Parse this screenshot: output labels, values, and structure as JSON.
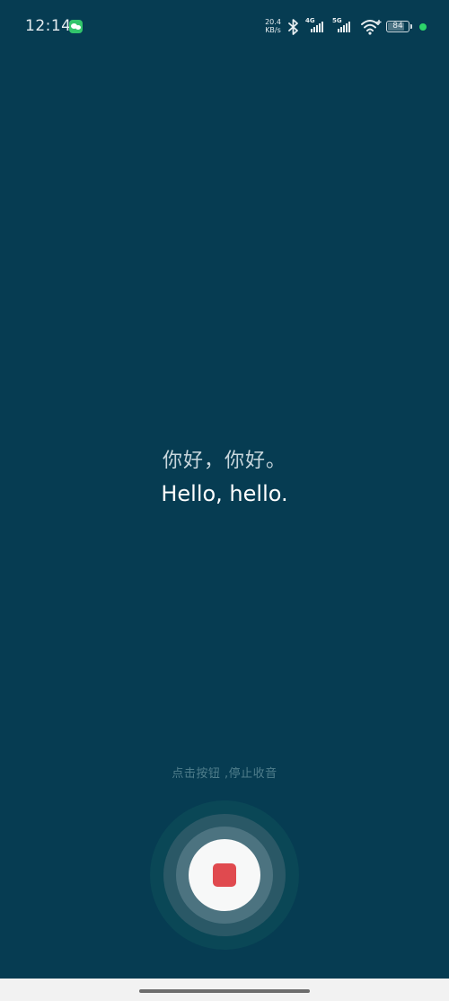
{
  "status_bar": {
    "time": "12:14",
    "notification_icon": "wechat-icon",
    "net_speed_value": "20.4",
    "net_speed_unit": "KB/s",
    "bluetooth_icon": "bluetooth-icon",
    "signal_1_tag": "4G",
    "signal_2_tag": "5G",
    "wifi_icon": "wifi-icon",
    "battery_level": "84",
    "battery_fraction": 0.84,
    "privacy_dot_color": "#2dd46a"
  },
  "transcript": {
    "source_text": "你好，你好。",
    "translated_text": "Hello, hello."
  },
  "controls": {
    "hint": "点击按钮 ,停止收音",
    "record_button_icon": "stop-icon",
    "record_accent_color": "#e04a4f"
  },
  "theme": {
    "background": "#063c52"
  }
}
